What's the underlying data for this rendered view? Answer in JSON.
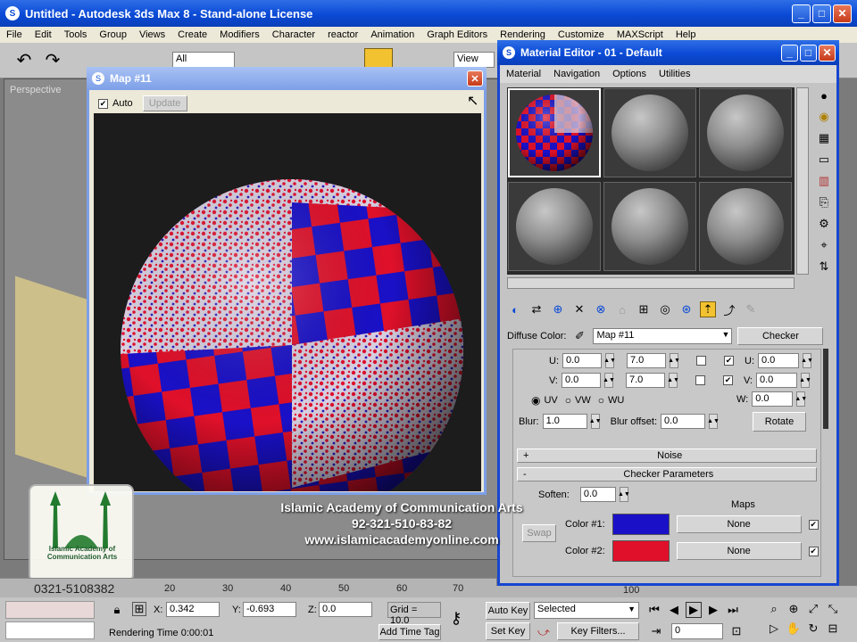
{
  "app": {
    "title": "Untitled - Autodesk 3ds Max 8 - Stand-alone License",
    "menu": [
      "File",
      "Edit",
      "Tools",
      "Group",
      "Views",
      "Create",
      "Modifiers",
      "Character",
      "reactor",
      "Animation",
      "Graph Editors",
      "Rendering",
      "Customize",
      "MAXScript",
      "Help"
    ],
    "toolbar_dropdown": "All",
    "view_dropdown": "View",
    "viewport_label": "Perspective"
  },
  "map_window": {
    "title": "Map #11",
    "auto_label": "Auto",
    "update_label": "Update"
  },
  "material_editor": {
    "title": "Material Editor - 01 - Default",
    "menu": [
      "Material",
      "Navigation",
      "Options",
      "Utilities"
    ],
    "diffuse_label": "Diffuse Color:",
    "map_name": "Map #11",
    "map_type": "Checker",
    "coords": {
      "u_offset": "0.0",
      "v_offset": "0.0",
      "u_tiling": "7.0",
      "v_tiling": "7.0",
      "u_angle": "0.0",
      "v_angle": "0.0",
      "w_angle": "0.0",
      "u_label": "U:",
      "v_label": "V:",
      "w_label": "W:",
      "uv": "UV",
      "vw": "VW",
      "wu": "WU",
      "blur_label": "Blur:",
      "blur": "1.0",
      "blur_offset_label": "Blur offset:",
      "blur_offset": "0.0",
      "rotate_label": "Rotate"
    },
    "rollouts": {
      "noise_sign": "+",
      "noise": "Noise",
      "checker_sign": "-",
      "checker": "Checker Parameters"
    },
    "checker": {
      "soften_label": "Soften:",
      "soften": "0.0",
      "maps_label": "Maps",
      "swap_label": "Swap",
      "color1_label": "Color #1:",
      "color1_map": "None",
      "color1_hex": "#1a10c8",
      "color2_label": "Color #2:",
      "color2_map": "None",
      "color2_hex": "#e0102a"
    }
  },
  "watermark": {
    "logo_text": "Islamic Academy of Communication Arts",
    "line1": "Islamic Academy of Communication Arts",
    "line2": "92-321-510-83-82",
    "line3": "www.islamicacademyonline.com",
    "phone": "0321-5108382"
  },
  "timeline": {
    "ticks": [
      "20",
      "30",
      "40",
      "50",
      "60",
      "70",
      "100"
    ]
  },
  "status": {
    "x_label": "X:",
    "x": "0.342",
    "y_label": "Y:",
    "y": "-0.693",
    "z_label": "Z:",
    "z": "0.0",
    "grid": "Grid = 10.0",
    "rendering_time": "Rendering Time  0:00:01",
    "add_time_tag": "Add Time Tag",
    "auto_key": "Auto Key",
    "selected": "Selected",
    "set_key": "Set Key",
    "key_filters": "Key Filters...",
    "frame": "0"
  },
  "colors": {
    "xp_blue": "#0a4ad6",
    "checker_red": "#e0102a",
    "checker_blue": "#1a10c8"
  }
}
